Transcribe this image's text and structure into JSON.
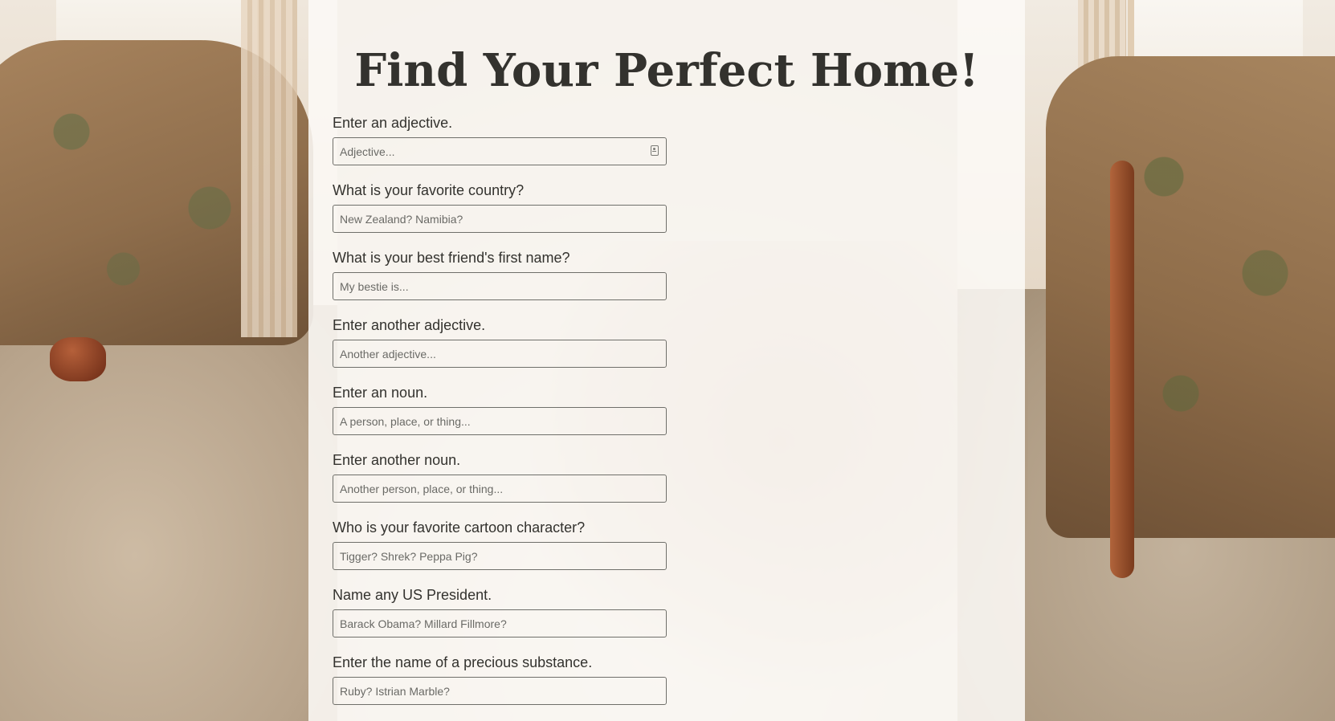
{
  "page": {
    "title": "Find Your Perfect Home!"
  },
  "fields": [
    {
      "label": "Enter an adjective.",
      "placeholder": "Adjective...",
      "value": ""
    },
    {
      "label": "What is your favorite country?",
      "placeholder": "New Zealand? Namibia?",
      "value": ""
    },
    {
      "label": "What is your best friend's first name?",
      "placeholder": "My bestie is...",
      "value": ""
    },
    {
      "label": "Enter another adjective.",
      "placeholder": "Another adjective...",
      "value": ""
    },
    {
      "label": "Enter an noun.",
      "placeholder": "A person, place, or thing...",
      "value": ""
    },
    {
      "label": "Enter another noun.",
      "placeholder": "Another person, place, or thing...",
      "value": ""
    },
    {
      "label": "Who is your favorite cartoon character?",
      "placeholder": "Tigger? Shrek? Peppa Pig?",
      "value": ""
    },
    {
      "label": "Name any US President.",
      "placeholder": "Barack Obama? Millard Fillmore?",
      "value": ""
    },
    {
      "label": "Enter the name of a precious substance.",
      "placeholder": "Ruby? Istrian Marble?",
      "value": ""
    }
  ],
  "icons": {
    "autofill": "contact-card-icon"
  },
  "colors": {
    "panel": "#fcf9f6",
    "text": "#33322e",
    "input_border": "#6f6f6a"
  }
}
